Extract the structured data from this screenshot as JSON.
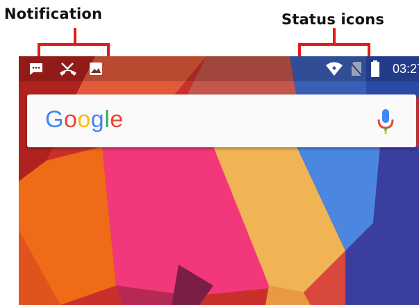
{
  "callouts": {
    "notification": "Notification",
    "status": "Status icons"
  },
  "statusbar": {
    "notification_icons": [
      "chat-icon",
      "missed-call-icon",
      "image-icon"
    ],
    "status_icons": [
      "wifi-icon",
      "no-sim-icon",
      "battery-icon"
    ],
    "time": "03:27"
  },
  "search": {
    "brand": [
      "G",
      "o",
      "o",
      "g",
      "l",
      "e"
    ],
    "brand_colors": [
      "#4285F4",
      "#EA4335",
      "#FBBC05",
      "#4285F4",
      "#34A853",
      "#EA4335"
    ],
    "mic_icon": "mic-icon"
  },
  "colors": {
    "callout_bracket": "#e31b1b",
    "statusbar_text": "#ffffff",
    "searchbar_bg": "#fafafa"
  }
}
